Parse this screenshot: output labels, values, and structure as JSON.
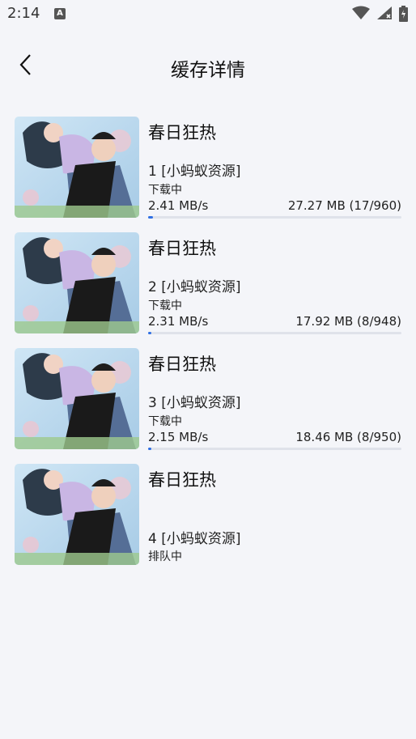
{
  "status_bar": {
    "time": "2:14",
    "notification_letter": "A"
  },
  "header": {
    "title": "缓存详情",
    "back_icon": "chevron-left-icon"
  },
  "items": [
    {
      "title": "春日狂热",
      "source": "1 [小蚂蚁资源]",
      "status": "下载中",
      "speed": "2.41 MB/s",
      "size": "27.27 MB (17/960)",
      "progress": 0.0177
    },
    {
      "title": "春日狂热",
      "source": "2 [小蚂蚁资源]",
      "status": "下载中",
      "speed": "2.31 MB/s",
      "size": "17.92 MB (8/948)",
      "progress": 0.0084
    },
    {
      "title": "春日狂热",
      "source": "3 [小蚂蚁资源]",
      "status": "下载中",
      "speed": "2.15 MB/s",
      "size": "18.46 MB (8/950)",
      "progress": 0.0084
    },
    {
      "title": "春日狂热",
      "source": "4 [小蚂蚁资源]",
      "status": "排队中"
    }
  ],
  "colors": {
    "accent": "#2f6fe4",
    "background": "#f4f5f9"
  }
}
